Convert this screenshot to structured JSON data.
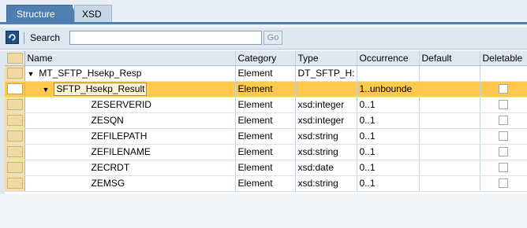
{
  "tabs": [
    {
      "label": "Structure"
    },
    {
      "label": "XSD"
    }
  ],
  "toolbar": {
    "refresh_icon": "refresh-icon",
    "search_label": "Search",
    "search_value": "",
    "go_label": "Go"
  },
  "table": {
    "columns": [
      "Name",
      "Category",
      "Type",
      "Occurrence",
      "Default",
      "Deletable"
    ],
    "rows": [
      {
        "name": "MT_SFTP_Hsekp_Resp",
        "category": "Element",
        "type": "DT_SFTP_H:",
        "occurrence": "",
        "default": "",
        "deletable": ""
      },
      {
        "name": "SFTP_Hsekp_Result",
        "category": "Element",
        "type": "",
        "occurrence": "1..unbounde",
        "default": "",
        "deletable": "checkbox"
      },
      {
        "name": "ZESERVERID",
        "category": "Element",
        "type": "xsd:integer",
        "occurrence": "0..1",
        "default": "",
        "deletable": "checkbox"
      },
      {
        "name": "ZESQN",
        "category": "Element",
        "type": "xsd:integer",
        "occurrence": "0..1",
        "default": "",
        "deletable": "checkbox"
      },
      {
        "name": "ZEFILEPATH",
        "category": "Element",
        "type": "xsd:string",
        "occurrence": "0..1",
        "default": "",
        "deletable": "checkbox"
      },
      {
        "name": "ZEFILENAME",
        "category": "Element",
        "type": "xsd:string",
        "occurrence": "0..1",
        "default": "",
        "deletable": "checkbox"
      },
      {
        "name": "ZECRDT",
        "category": "Element",
        "type": "xsd:date",
        "occurrence": "0..1",
        "default": "",
        "deletable": "checkbox"
      },
      {
        "name": "ZEMSG",
        "category": "Element",
        "type": "xsd:string",
        "occurrence": "0..1",
        "default": "",
        "deletable": "checkbox"
      }
    ]
  },
  "colors": {
    "tab_active": "#4f7fb0",
    "selected_row": "#ffc94f",
    "header_bg": "#dfe8f1"
  }
}
